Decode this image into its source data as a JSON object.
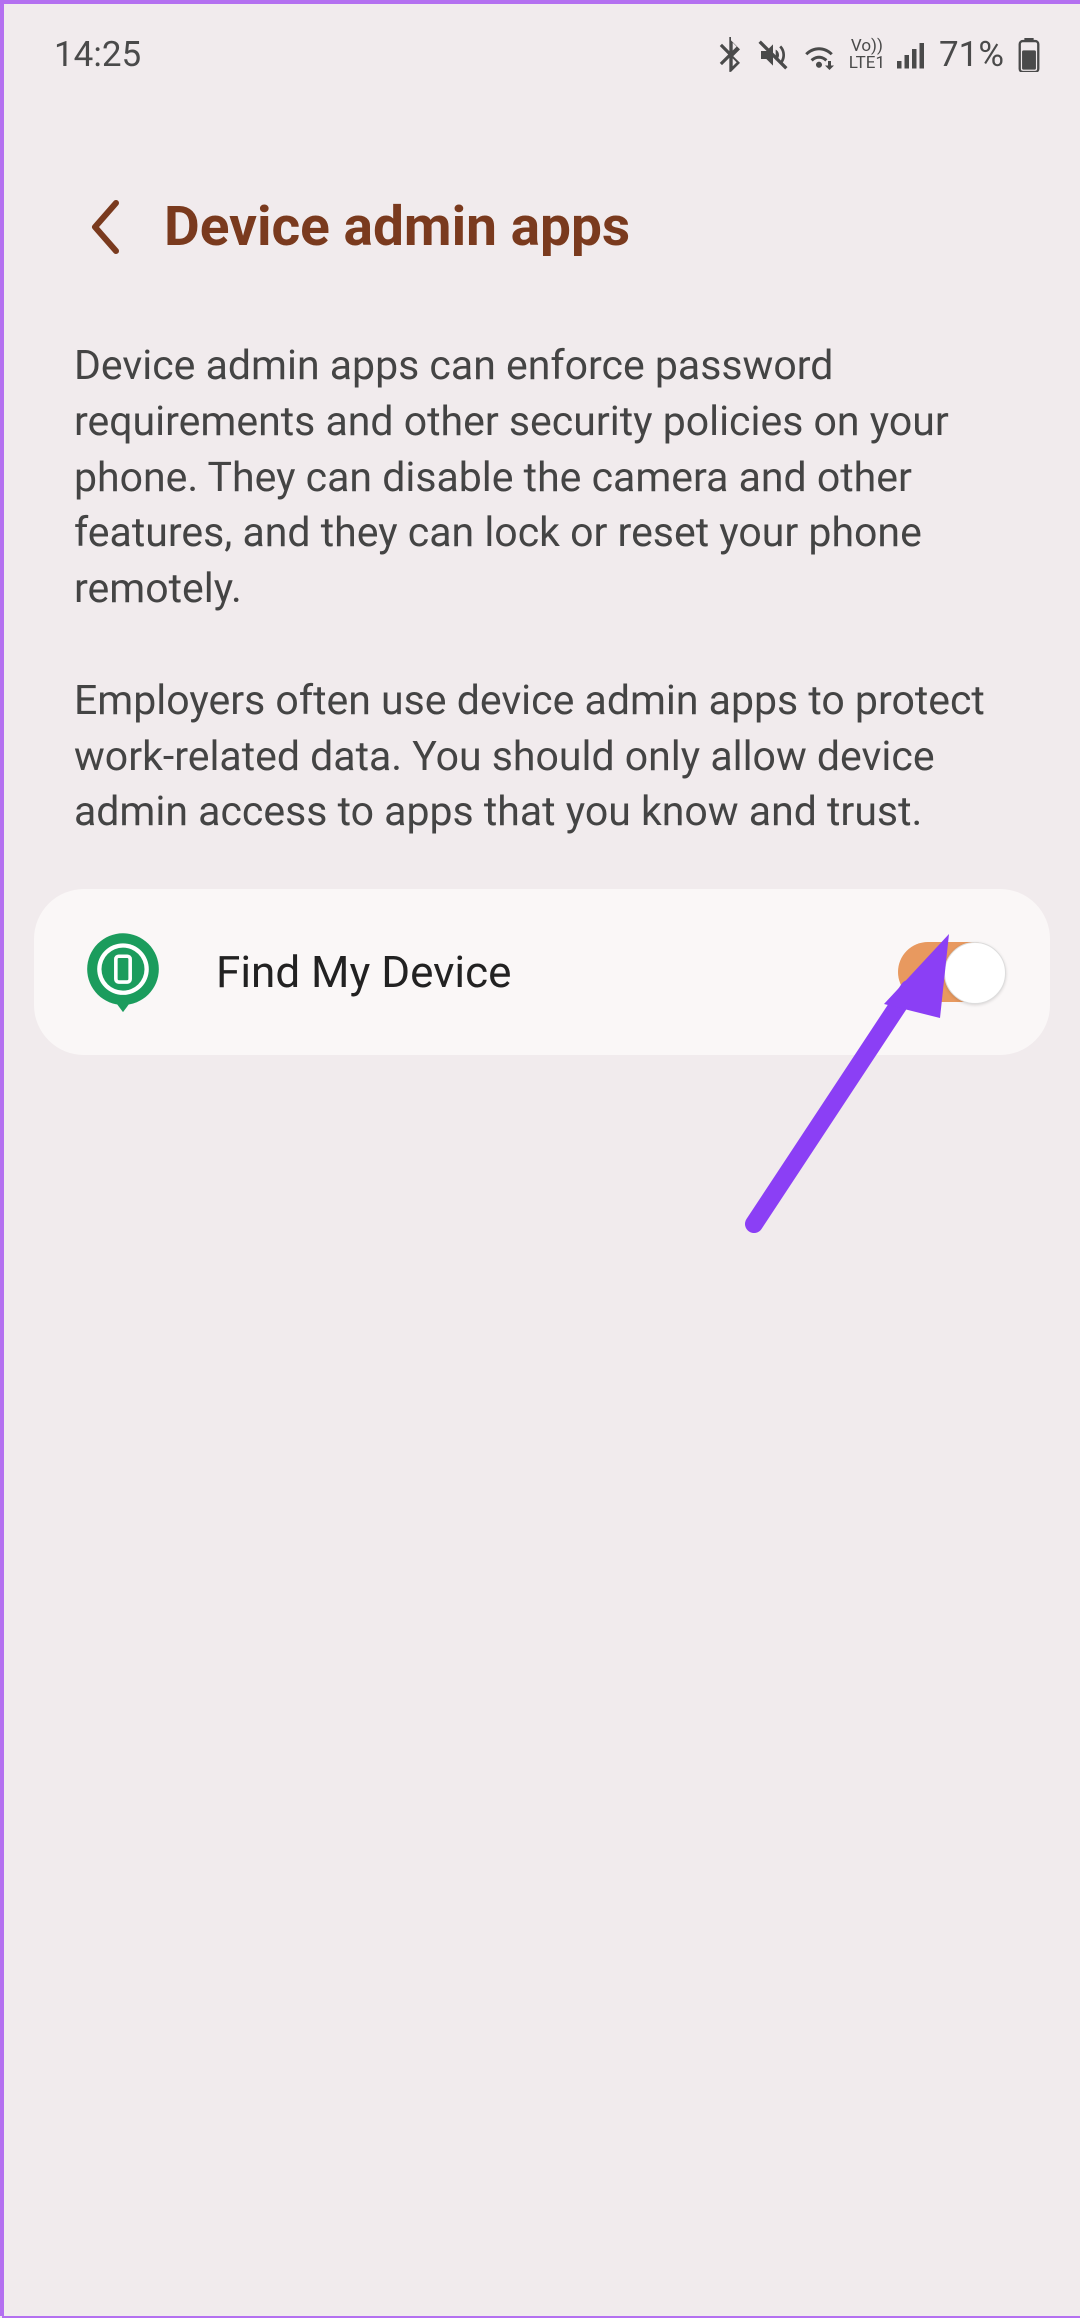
{
  "status": {
    "time": "14:25",
    "battery_pct": "71%",
    "volte_top": "Vo))",
    "volte_bottom": "LTE1"
  },
  "header": {
    "title": "Device admin apps"
  },
  "description": {
    "para1": "Device admin apps can enforce password requirements and other security policies on your phone. They can disable the camera and other features, and they can lock or reset your phone remotely.",
    "para2": "Employers often use device admin apps to protect work-related data. You should only allow device admin access to apps that you know and trust."
  },
  "apps": {
    "find_my_device": {
      "label": "Find My Device",
      "enabled": true
    }
  }
}
